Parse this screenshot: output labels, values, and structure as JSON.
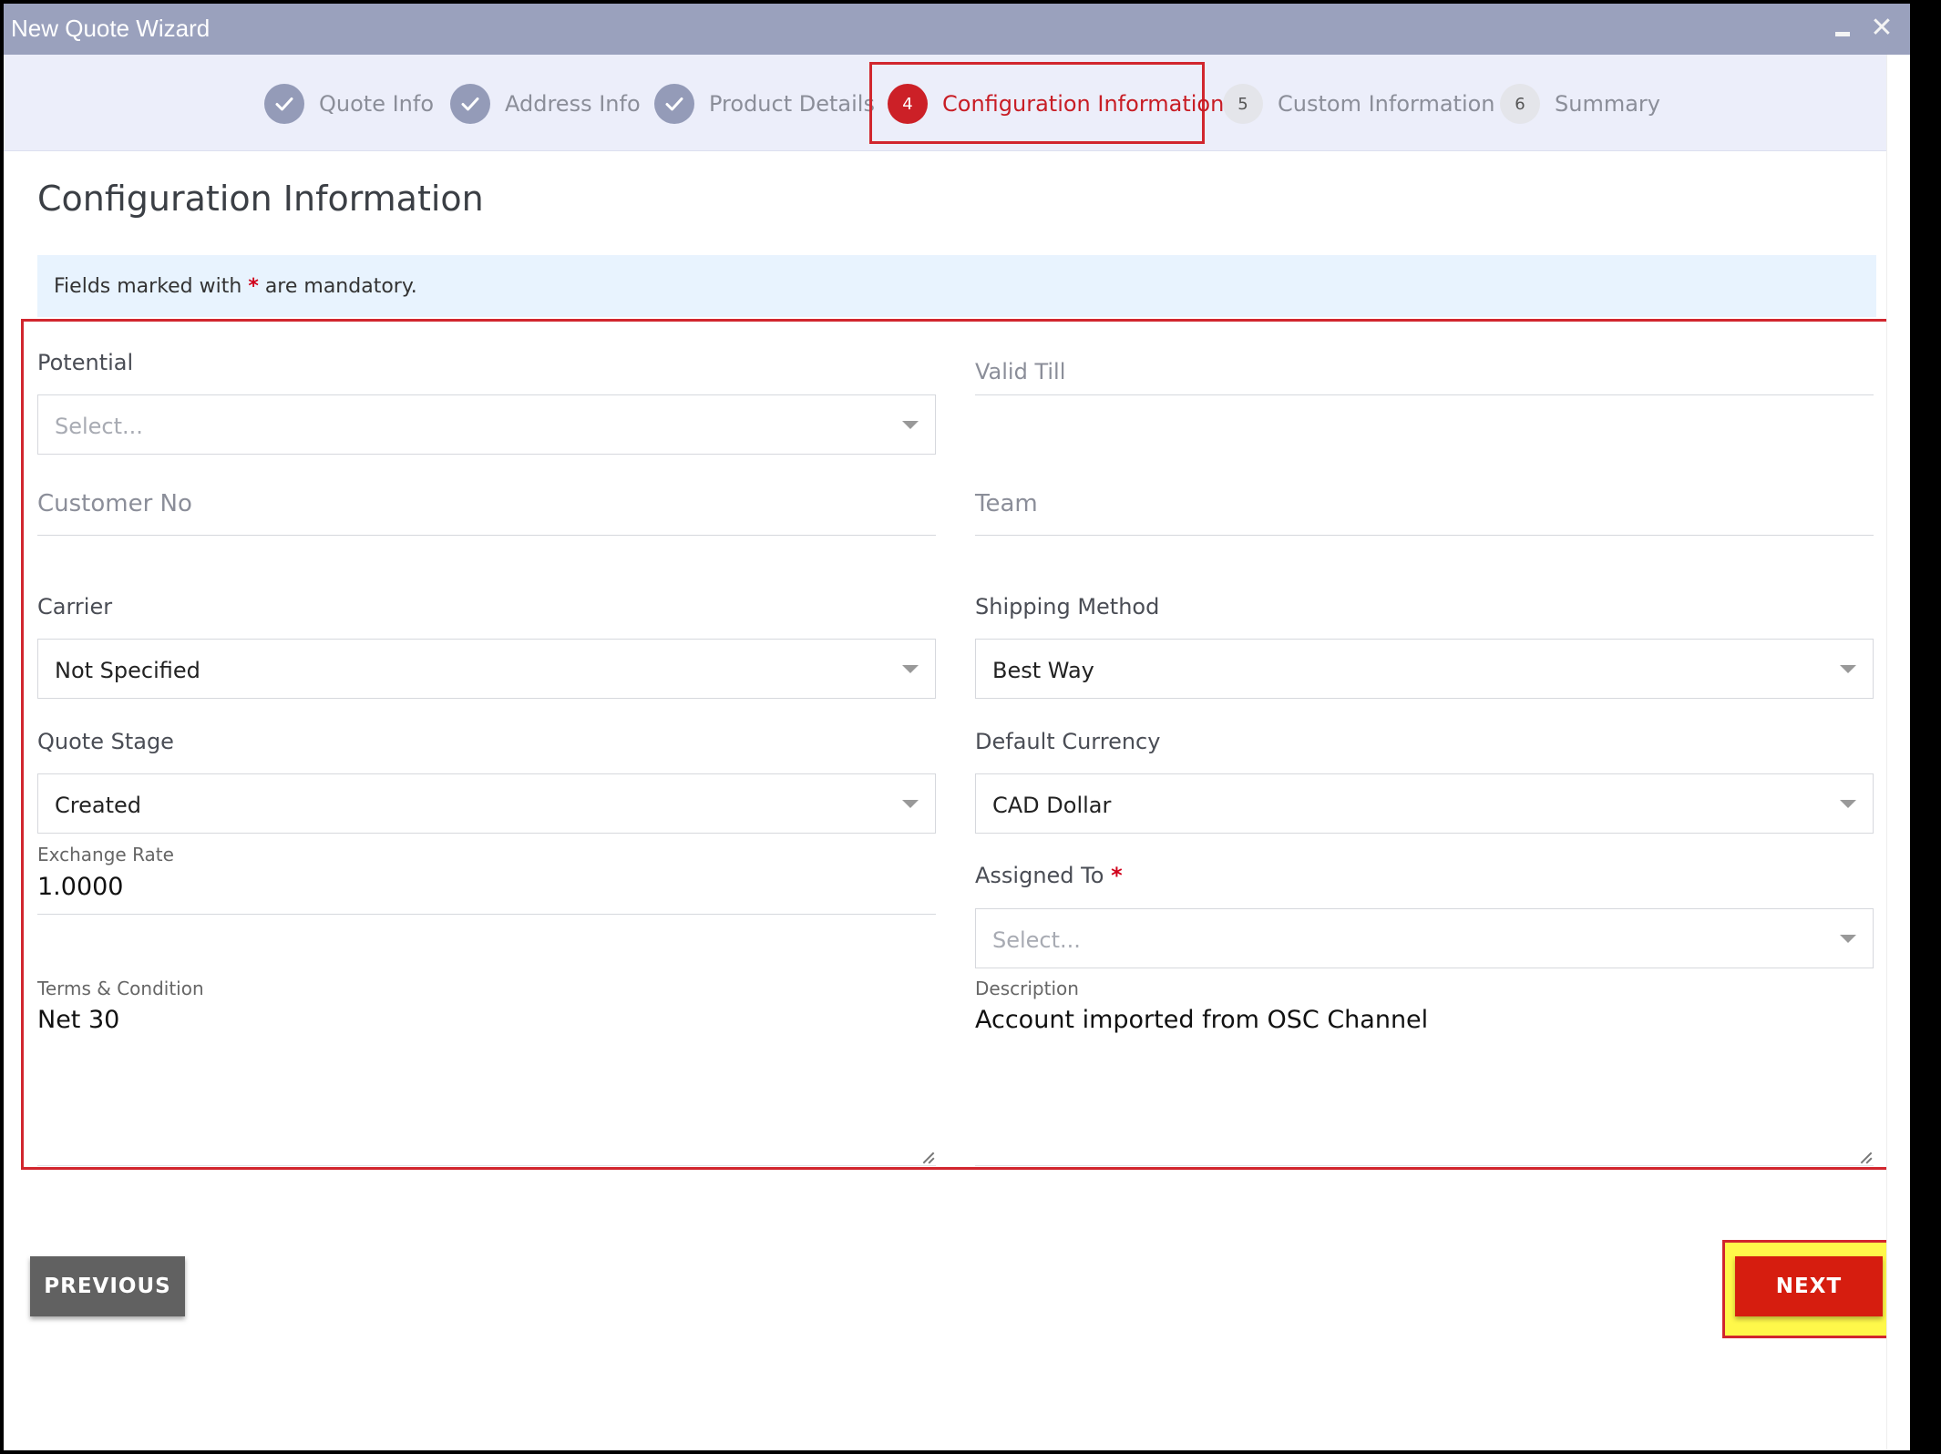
{
  "window": {
    "title": "New Quote Wizard",
    "minimize_glyph": "",
    "close_glyph": "✕"
  },
  "steps": [
    {
      "number": "",
      "label": "Quote Info",
      "state": "done"
    },
    {
      "number": "",
      "label": "Address Info",
      "state": "done"
    },
    {
      "number": "",
      "label": "Product Details",
      "state": "done"
    },
    {
      "number": "4",
      "label": "Configuration Information",
      "state": "active"
    },
    {
      "number": "5",
      "label": "Custom Information",
      "state": "pending"
    },
    {
      "number": "6",
      "label": "Summary",
      "state": "pending"
    }
  ],
  "page": {
    "title": "Configuration Information",
    "banner_before": "Fields marked with ",
    "banner_star": "*",
    "banner_after": " are mandatory."
  },
  "form": {
    "potential": {
      "label": "Potential",
      "placeholder": "Select..."
    },
    "valid_till": {
      "label": "Valid Till"
    },
    "customer_no": {
      "label": "Customer No"
    },
    "team": {
      "label": "Team"
    },
    "carrier": {
      "label": "Carrier",
      "value": "Not Specified"
    },
    "shipping_method": {
      "label": "Shipping Method",
      "value": "Best Way"
    },
    "quote_stage": {
      "label": "Quote Stage",
      "value": "Created"
    },
    "default_currency": {
      "label": "Default Currency",
      "value": "CAD Dollar"
    },
    "exchange_rate": {
      "label": "Exchange Rate",
      "value": "1.0000"
    },
    "assigned_to": {
      "label": "Assigned To ",
      "required": "*",
      "placeholder": "Select..."
    },
    "terms": {
      "label": "Terms & Condition",
      "value": "Net 30"
    },
    "description": {
      "label": "Description",
      "value": "Account imported from OSC Channel"
    }
  },
  "buttons": {
    "previous": "PREVIOUS",
    "next": "NEXT"
  },
  "colors": {
    "titlebar": "#9aa1bd",
    "accent_red": "#cc2027",
    "next_button": "#d61d0f",
    "highlight_yellow": "#fff84a",
    "banner_bg": "#e8f3fe"
  }
}
